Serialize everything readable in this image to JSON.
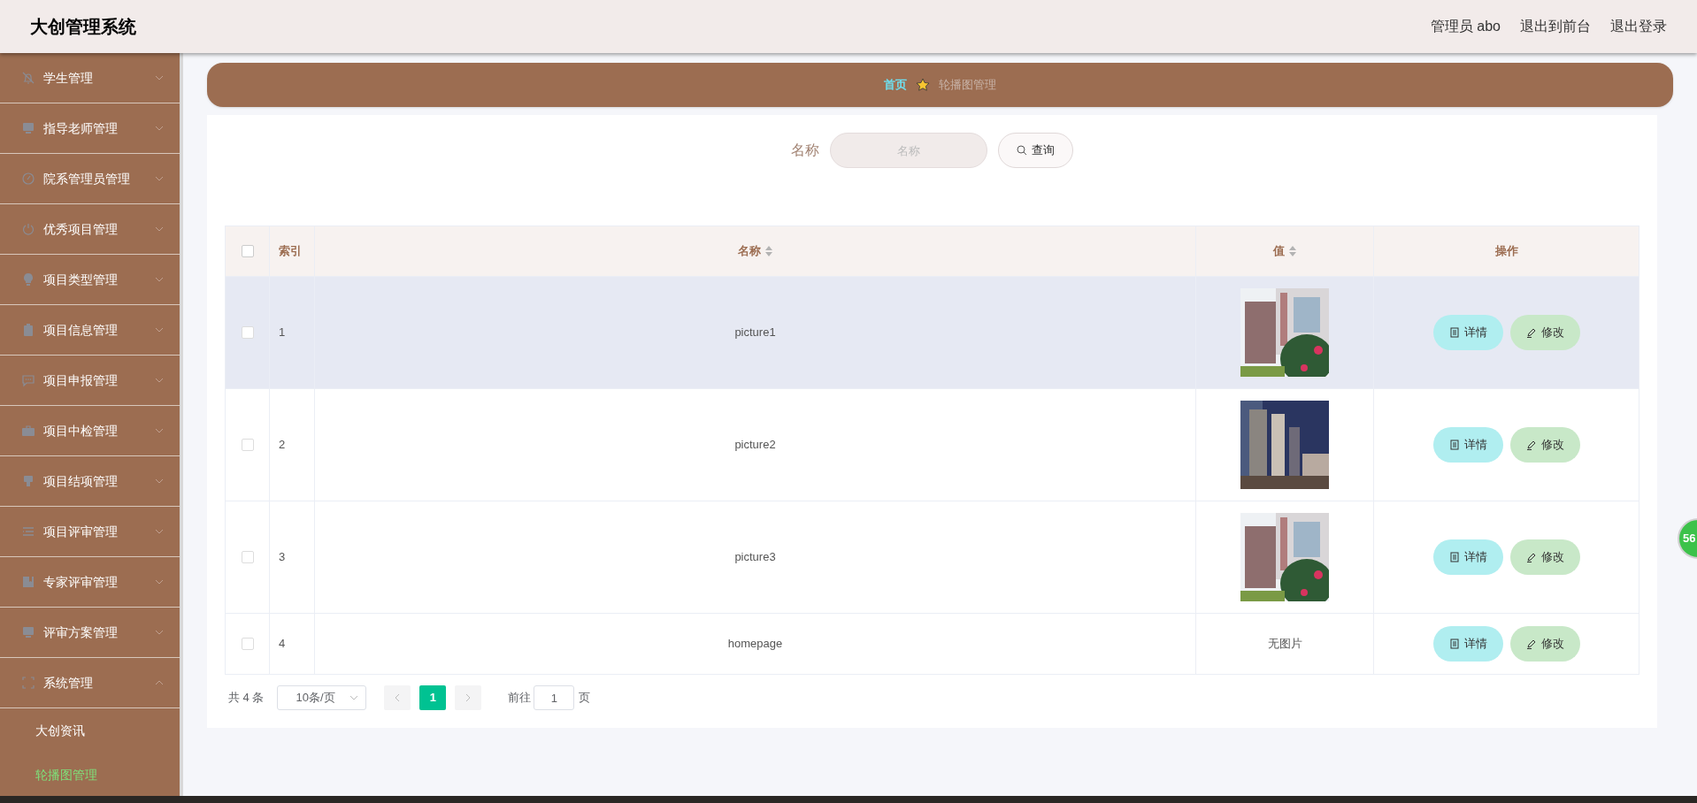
{
  "header": {
    "title": "大创管理系统",
    "links": [
      "管理员 abo",
      "退出到前台",
      "退出登录"
    ]
  },
  "sidebar": {
    "items": [
      {
        "label": "学生管理",
        "expanded": false
      },
      {
        "label": "指导老师管理",
        "expanded": false
      },
      {
        "label": "院系管理员管理",
        "expanded": false
      },
      {
        "label": "优秀项目管理",
        "expanded": false
      },
      {
        "label": "项目类型管理",
        "expanded": false
      },
      {
        "label": "项目信息管理",
        "expanded": false
      },
      {
        "label": "项目申报管理",
        "expanded": false
      },
      {
        "label": "项目中检管理",
        "expanded": false
      },
      {
        "label": "项目结项管理",
        "expanded": false
      },
      {
        "label": "项目评审管理",
        "expanded": false
      },
      {
        "label": "专家评审管理",
        "expanded": false
      },
      {
        "label": "评审方案管理",
        "expanded": false
      },
      {
        "label": "系统管理",
        "expanded": true,
        "children": [
          {
            "label": "大创资讯",
            "selected": false
          },
          {
            "label": "轮播图管理",
            "selected": true
          }
        ]
      }
    ]
  },
  "breadcrumb": [
    "首页",
    "轮播图管理"
  ],
  "search": {
    "label": "名称",
    "placeholder": "名称",
    "button": "查询"
  },
  "table": {
    "columns": [
      "索引",
      "名称",
      "值",
      "操作"
    ],
    "rows": [
      {
        "checked": false,
        "highlighted": true,
        "index": "1",
        "name": "picture1",
        "value": {
          "kind": "picture"
        },
        "actions": [
          "详情",
          "修改"
        ]
      },
      {
        "checked": false,
        "highlighted": false,
        "index": "2",
        "name": "picture2",
        "value": {
          "kind": "picture"
        },
        "actions": [
          "详情",
          "修改"
        ]
      },
      {
        "checked": false,
        "highlighted": false,
        "index": "3",
        "name": "picture3",
        "value": {
          "kind": "picture"
        },
        "actions": [
          "详情",
          "修改"
        ]
      },
      {
        "checked": false,
        "highlighted": false,
        "index": "4",
        "name": "homepage",
        "value": {
          "kind": "text",
          "text": "无图片"
        },
        "actions": [
          "详情",
          "修改"
        ]
      }
    ],
    "select_all_checked": false
  },
  "pagination": {
    "total": "共 4 条",
    "page_size": "10条/页",
    "pages": [
      {
        "label": "1",
        "selected": true
      }
    ],
    "goto_label": "前往",
    "goto_value": "1",
    "goto_suffix": "页"
  },
  "floating_badge": "56"
}
